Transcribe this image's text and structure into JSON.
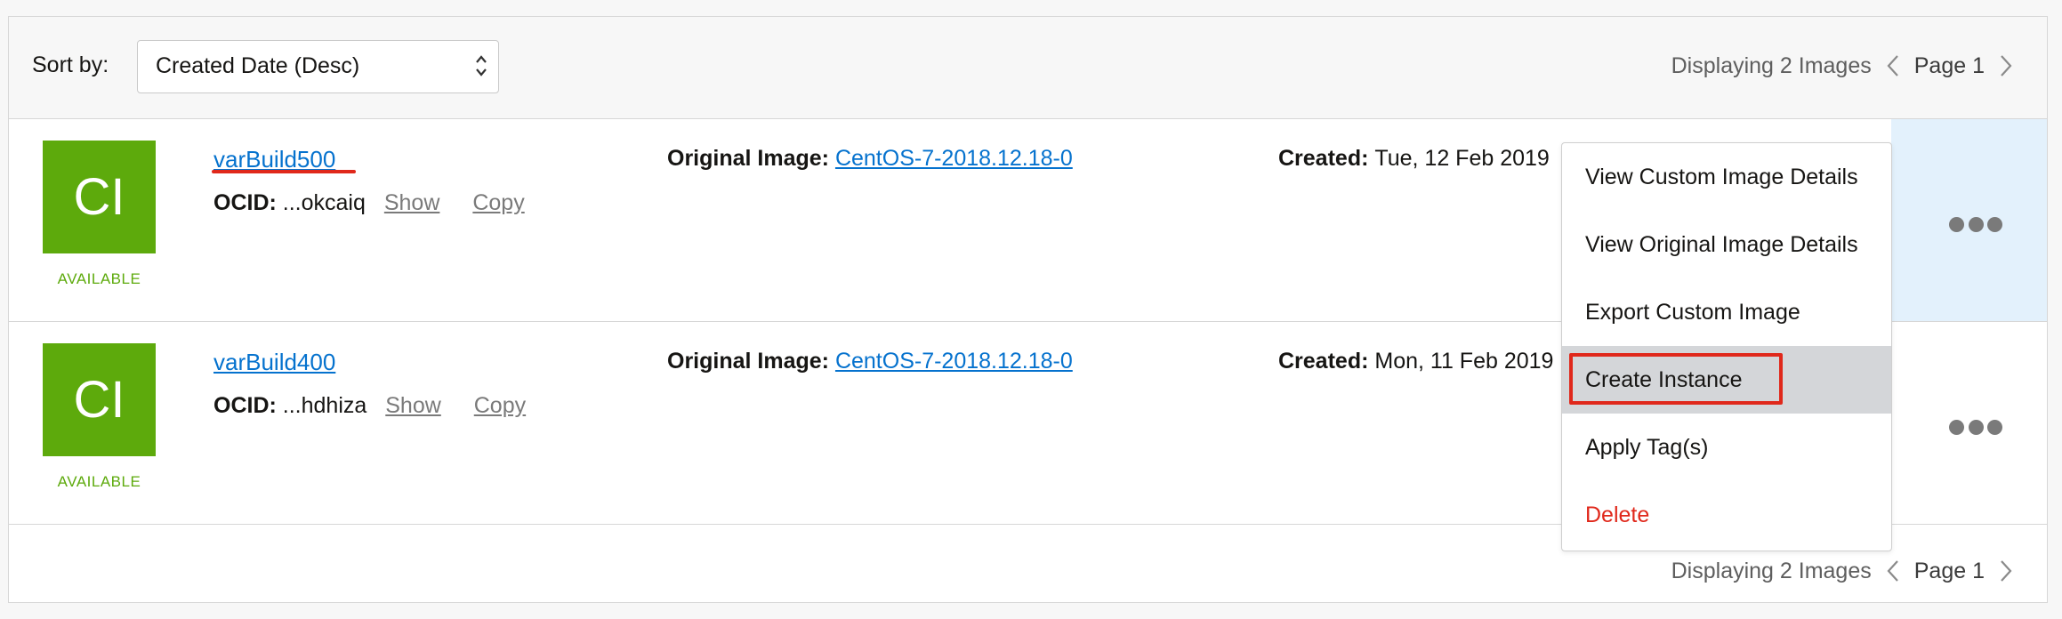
{
  "toolbar": {
    "sort_label": "Sort by:",
    "sort_value": "Created Date (Desc)",
    "display_text": "Displaying 2 Images",
    "page_text": "Page 1"
  },
  "rows": [
    {
      "avatar_text": "CI",
      "status": "AVAILABLE",
      "name": "varBuild500",
      "ocid_label": "OCID:",
      "ocid_value": "...okcaiq",
      "show_label": "Show",
      "copy_label": "Copy",
      "original_label": "Original Image:",
      "original_value": "CentOS-7-2018.12.18-0",
      "created_label": "Created:",
      "created_value": "Tue, 12 Feb 2019"
    },
    {
      "avatar_text": "CI",
      "status": "AVAILABLE",
      "name": "varBuild400",
      "ocid_label": "OCID:",
      "ocid_value": "...hdhiza",
      "show_label": "Show",
      "copy_label": "Copy",
      "original_label": "Original Image:",
      "original_value": "CentOS-7-2018.12.18-0",
      "created_label": "Created:",
      "created_value": "Mon, 11 Feb 2019"
    }
  ],
  "menu": {
    "items": [
      {
        "label": "View Custom Image Details"
      },
      {
        "label": "View Original Image Details"
      },
      {
        "label": "Export Custom Image"
      },
      {
        "label": "Create Instance"
      },
      {
        "label": "Apply Tag(s)"
      },
      {
        "label": "Delete"
      }
    ]
  },
  "footer": {
    "display_text": "Displaying 2 Images",
    "page_text": "Page 1"
  },
  "colors": {
    "accent_link": "#0572ce",
    "status_green": "#5daa0c",
    "danger_red": "#e0281b",
    "annotation_red": "#e0281b"
  }
}
